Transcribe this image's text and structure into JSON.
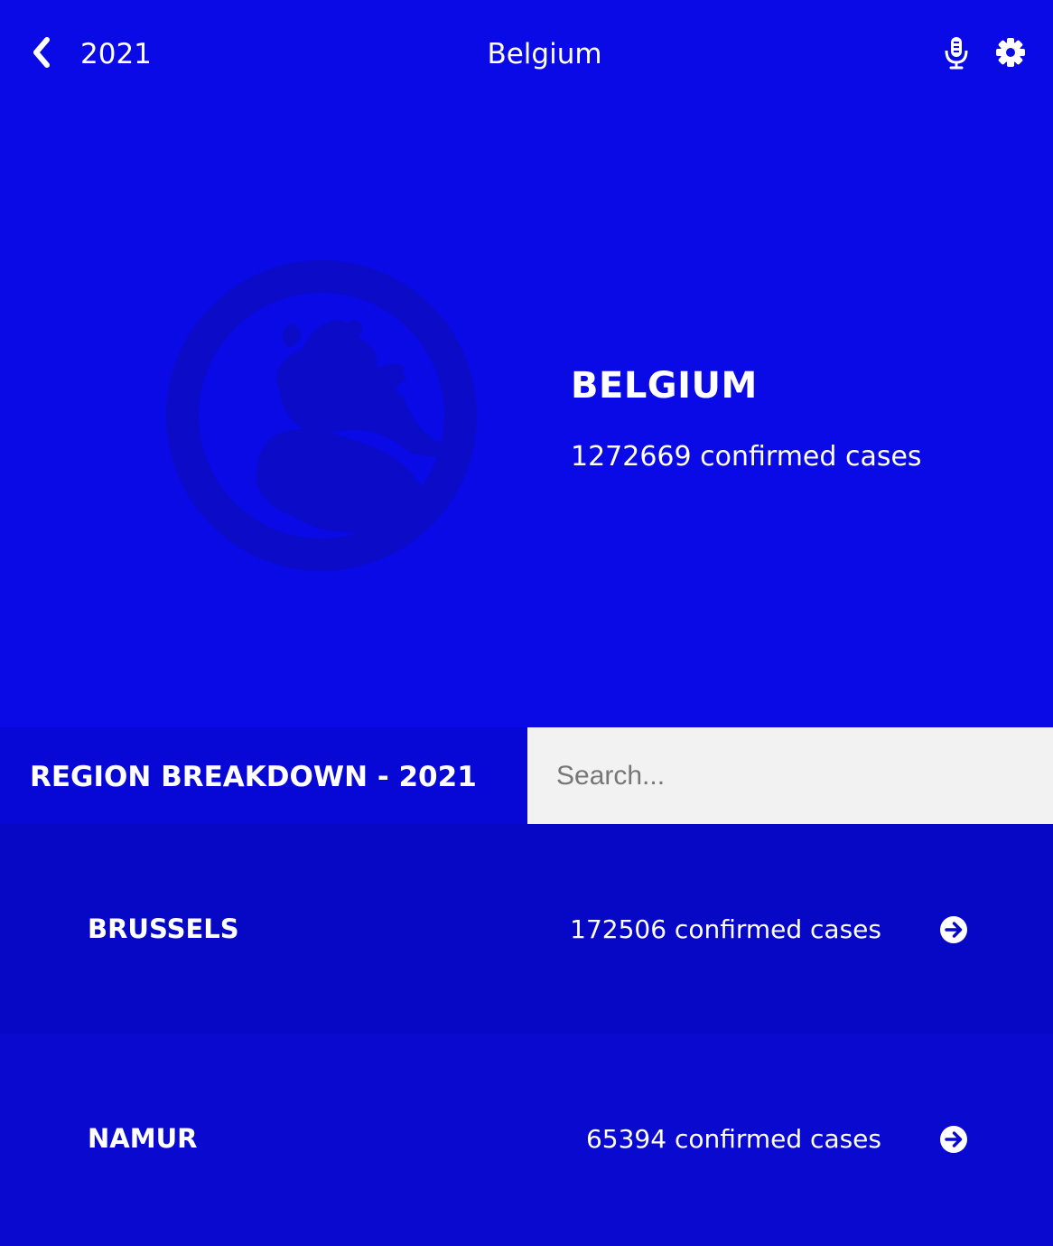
{
  "header": {
    "back_icon": "chevron-left-icon",
    "year": "2021",
    "title": "Belgium",
    "mic_icon": "microphone-icon",
    "settings_icon": "gear-icon"
  },
  "hero": {
    "globe_icon": "globe-europe-icon",
    "country_name": "BELGIUM",
    "cases_text": "1272669 confirmed cases"
  },
  "breakdown": {
    "title": "REGION BREAKDOWN - 2021",
    "search_placeholder": "Search..."
  },
  "regions": [
    {
      "name": "BRUSSELS",
      "cases_text": "172506 confirmed cases",
      "icon": "arrow-circle-right-icon"
    },
    {
      "name": "NAMUR",
      "cases_text": "65394 confirmed cases",
      "icon": "arrow-circle-right-icon"
    }
  ],
  "colors": {
    "background": "#0a0ae6",
    "breakdown_title_bg": "#0808d6",
    "row_dark": "#0707c6",
    "row_light": "#0909cf",
    "globe": "#0b0bc8",
    "search_bg": "#f2f2f2",
    "text": "#ffffff"
  }
}
